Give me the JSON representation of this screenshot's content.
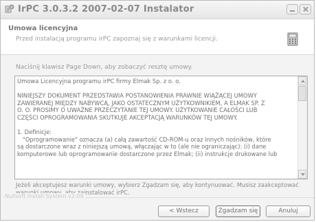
{
  "window": {
    "title": "IrPC 3.0.3.2 2007-02-07 Instalator"
  },
  "header": {
    "title": "Umowa licencyjna",
    "subtitle": "Przed instalacją programu irPC zapoznaj się z warunkami licencji."
  },
  "instruction": "Naciśnij klawisz Page Down, aby zobaczyć resztę umowy.",
  "license": {
    "lines": [
      "Umowa Licencyjna programu irPC firmy Elmak Sp. z o. o.",
      "NINIEJSZY DOKUMENT PRZEDSTAWIA POSTANOWIENIA PRAWNIE WIĄŻĄCEJ UMOWY",
      "ZAWIERANEJ MIĘDZY NABYWCĄ, JAKO OSTATECZNYM UŻYTKOWNIKIEM, A ELMAK SP. Z",
      "O. O. PROSIMY O UWAŻNE PRZECZYTANIE TEJ UMOWY. UŻYTKOWANIE CAŁOŚCI LUB",
      "CZĘŚCI OPROGRAMOWANIA SKUTKUJE AKCEPTACJĄ WARUNKÓW TEJ UMOWY.",
      "1. Definicje:",
      "   \"Oprogramowanie\" oznacza (a) całą zawartość CD-ROM-u oraz innych nośników, które",
      "są dostarczone wraz z niniejszą umową, włączając w to (ale nie ograniczając): (i) dane",
      "komputerowe lub oprogramowanie dostarczone przez Elmak; (ii) instrukcje drukowane lub"
    ]
  },
  "accept_text": "Jeżeli akceptujesz warunki umowy, wybierz Zgadzam się, aby kontynuować. Musisz zaakceptować warunki umowy, aby zainstalować irPC.",
  "brand": "Nullsoft Install System v2.09",
  "buttons": {
    "back": "< Wstecz",
    "agree": "Zgadzam się",
    "cancel": "Anuluj"
  }
}
